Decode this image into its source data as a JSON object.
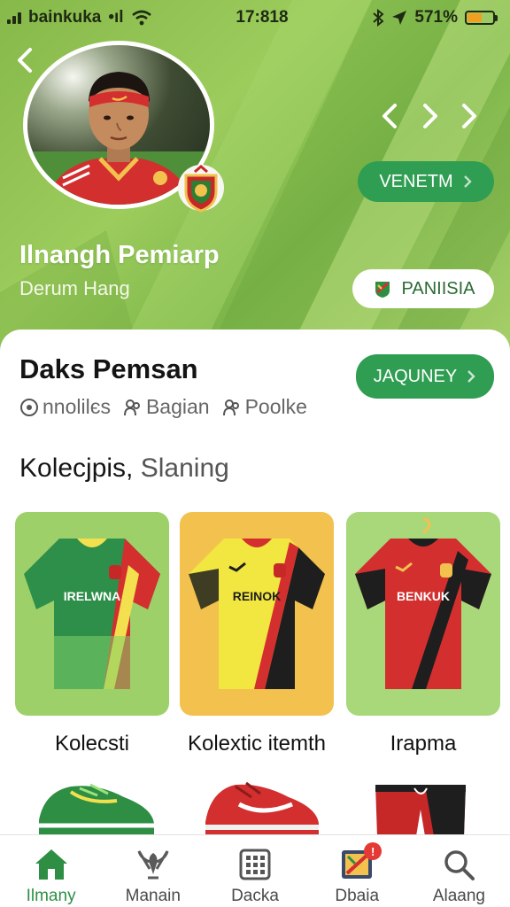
{
  "status_bar": {
    "carrier": "bainkuka",
    "network": "•ıl",
    "time": "17:818",
    "battery": "571%",
    "battery_level": 0.57
  },
  "profile": {
    "name": "Ilnangh Pemiarp",
    "subtitle": "Derum Hang"
  },
  "buttons": {
    "venetm": "VENETM",
    "panisia": "PANIISIA",
    "jaquney": "JAQUNEY"
  },
  "section": {
    "title": "Daks Pemsan",
    "meta": [
      "nnolilєs",
      "Bagian",
      "Poolke"
    ]
  },
  "collection": {
    "title": "Kolecjpis,",
    "title_light": "Slaning"
  },
  "jerseys": [
    {
      "label": "Kolecsti",
      "text": "IRELWNA"
    },
    {
      "label": "Kolextic itemth",
      "text": "REINOK"
    },
    {
      "label": "Irapma",
      "text": "BENKUK"
    }
  ],
  "nav": [
    {
      "label": "Ilmany",
      "icon": "home-icon"
    },
    {
      "label": "Manain",
      "icon": "eagle-icon"
    },
    {
      "label": "Dacka",
      "icon": "grid-icon"
    },
    {
      "label": "Dbaia",
      "icon": "shop-icon",
      "badge": "!"
    },
    {
      "label": "Alaang",
      "icon": "search-icon"
    }
  ],
  "colors": {
    "accent": "#2f9d52",
    "hero": "#8fc452",
    "jersey_red": "#d32f2f",
    "jersey_yellow": "#f2d640"
  }
}
